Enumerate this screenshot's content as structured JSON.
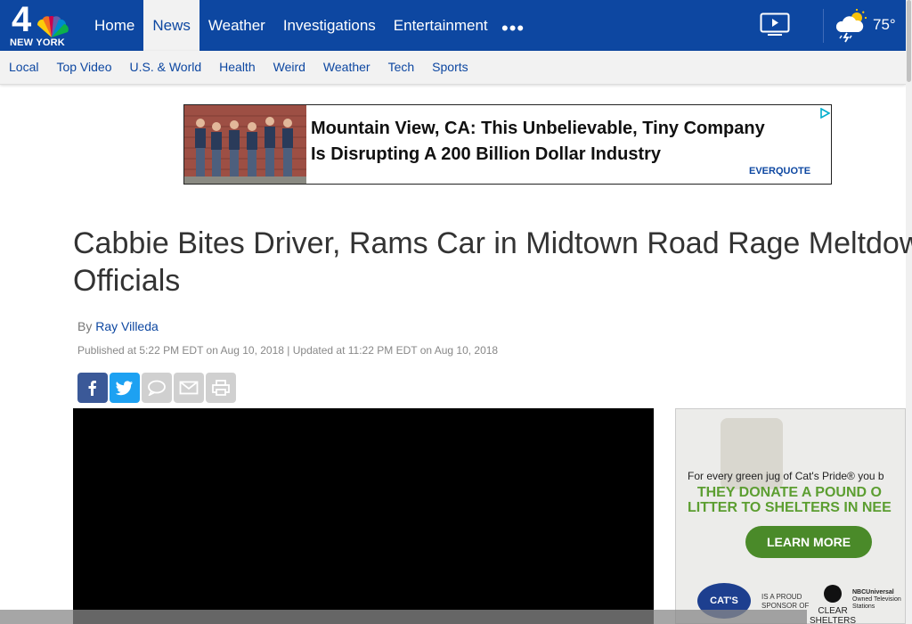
{
  "header": {
    "logo_number": "4",
    "logo_city": "NEW YORK",
    "main_nav": [
      {
        "label": "Home",
        "active": false
      },
      {
        "label": "News",
        "active": true
      },
      {
        "label": "Weather",
        "active": false
      },
      {
        "label": "Investigations",
        "active": false
      },
      {
        "label": "Entertainment",
        "active": false
      }
    ],
    "more_label": "•••",
    "video_icon": "tv-play-icon",
    "weather_icon": "storm-cloud-sun-icon",
    "temperature": "75°",
    "sub_nav": [
      "Local",
      "Top Video",
      "U.S. & World",
      "Health",
      "Weird",
      "Weather",
      "Tech",
      "Sports"
    ]
  },
  "banner_ad": {
    "line1": "Mountain View, CA: This Unbelievable, Tiny Company",
    "line2": "Is Disrupting A 200 Billion Dollar Industry",
    "brand": "EVERQUOTE"
  },
  "article": {
    "title_line1": "Cabbie Bites Driver, Rams Car in Midtown Road Rage Meltdown",
    "title_line2": "Officials",
    "by_label": "By",
    "author": "Ray Villeda",
    "published": "Published at 5:22 PM EDT on Aug 10, 2018 | Updated at 11:22 PM EDT on Aug 10, 2018",
    "share_buttons": [
      "facebook-icon",
      "twitter-icon",
      "comment-icon",
      "email-icon",
      "print-icon"
    ]
  },
  "side_ad": {
    "tagline": "For every green jug of Cat's Pride® you b",
    "headline1": "THEY DONATE A POUND O",
    "headline2": "LITTER TO SHELTERS IN NEE",
    "button": "LEARN MORE",
    "brand1": "CAT'S PRIDE",
    "proud1": "IS A PROUD",
    "proud2": "SPONSOR OF",
    "brand2_line1": "CLEAR",
    "brand2_line2": "SHELTERS",
    "nbcu_line1": "NBCUniversal",
    "nbcu_line2": "Owned Television Stations"
  }
}
